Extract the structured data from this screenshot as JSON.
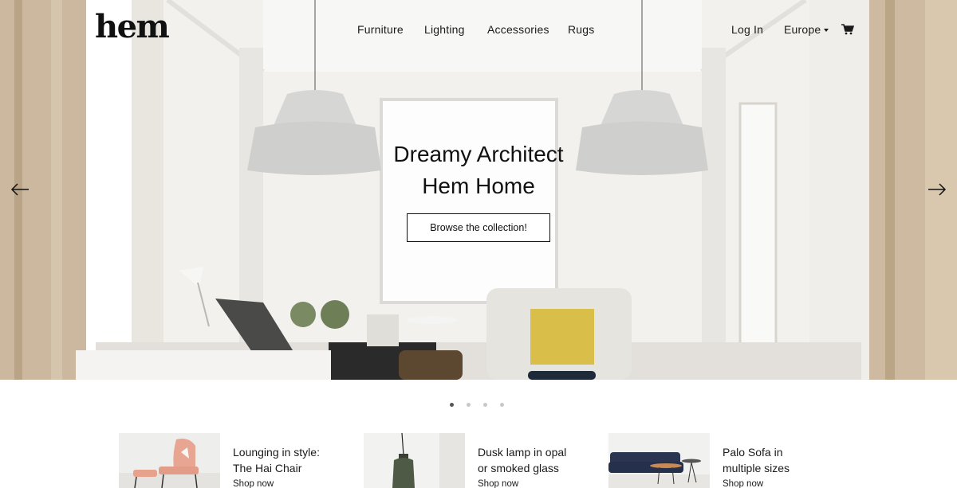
{
  "brand": {
    "logo": "hem"
  },
  "nav": {
    "links": [
      "Furniture",
      "Lighting",
      "Accessories",
      "Rugs"
    ],
    "login": "Log In",
    "region": "Europe",
    "cart_icon": "cart-icon"
  },
  "hero": {
    "title_line1": "Dreamy Architect",
    "title_line2": "Hem Home",
    "button": "Browse the collection!",
    "prev_icon": "arrow-left-icon",
    "next_icon": "arrow-right-icon"
  },
  "carousel": {
    "slides": 4,
    "active": 1
  },
  "products": [
    {
      "line1": "Lounging in style:",
      "line2": "The Hai Chair",
      "cta": "Shop now"
    },
    {
      "line1": "Dusk lamp in opal",
      "line2": "or smoked glass",
      "cta": "Shop now"
    },
    {
      "line1": "Palo Sofa in",
      "line2": "multiple sizes",
      "cta": "Shop now"
    }
  ]
}
